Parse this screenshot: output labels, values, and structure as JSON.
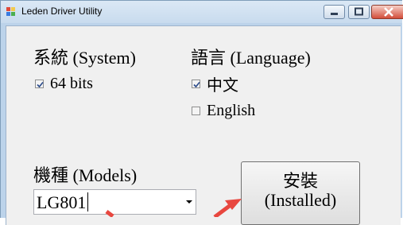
{
  "window": {
    "title": "Leden Driver Utility",
    "controls": [
      "minimize",
      "maximize",
      "close"
    ]
  },
  "system": {
    "heading": "系統 (System)",
    "options": [
      {
        "label": "64 bits",
        "checked": true
      }
    ]
  },
  "language": {
    "heading": "語言 (Language)",
    "options": [
      {
        "label": "中文",
        "checked": true
      },
      {
        "label": "English",
        "checked": false
      }
    ]
  },
  "models": {
    "heading": "機種 (Models)",
    "selected": "LG801"
  },
  "install_button": {
    "line1": "安裝",
    "line2": "(Installed)"
  },
  "colors": {
    "annotation_arrow": "#e8473f"
  }
}
